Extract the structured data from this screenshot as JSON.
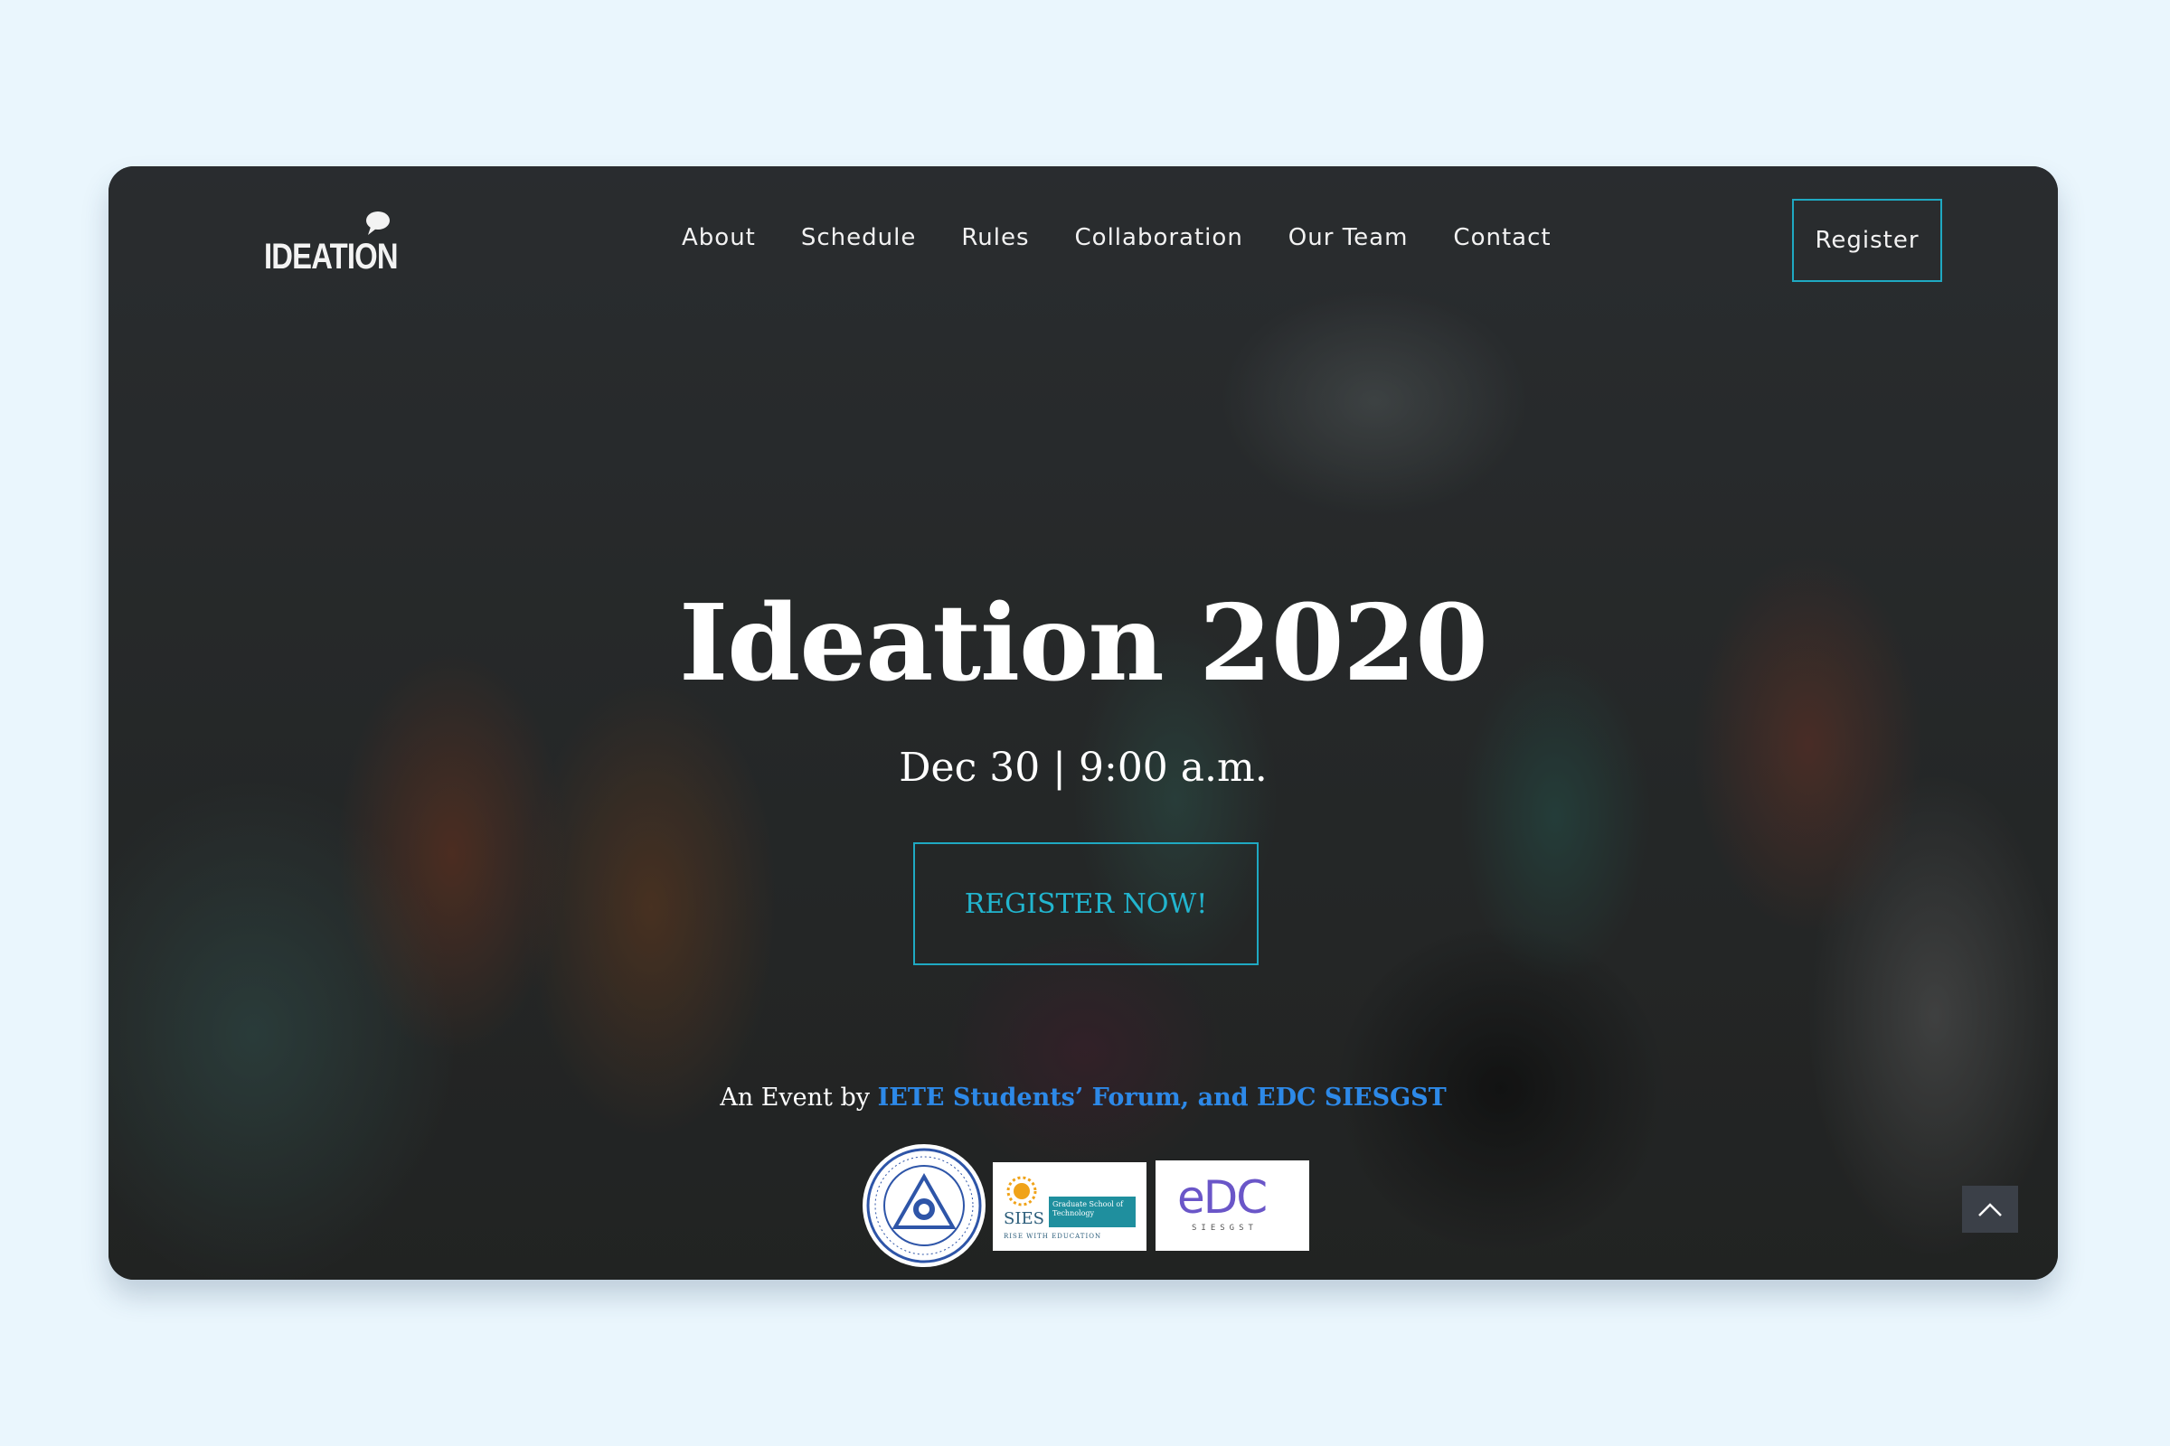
{
  "brand": {
    "logo_text": "IDEATION"
  },
  "nav": {
    "items": [
      {
        "label": "About"
      },
      {
        "label": "Schedule"
      },
      {
        "label": "Rules"
      },
      {
        "label": "Collaboration"
      },
      {
        "label": "Our Team"
      },
      {
        "label": "Contact"
      }
    ],
    "register_label": "Register"
  },
  "hero": {
    "title": "Ideation 2020",
    "date": "Dec 30 | 9:00 a.m.",
    "cta_label": "REGISTER NOW!",
    "event_prefix": "An Event by",
    "event_link": "IETE Students’ Forum, and EDC SIESGST"
  },
  "partners": {
    "sies": {
      "name": "SIES",
      "box_text": "Graduate School of Technology",
      "tagline": "RISE WITH EDUCATION"
    },
    "edc": {
      "name": "eDC",
      "sub": "SIESGST"
    }
  },
  "colors": {
    "page_bg": "#eaf6fd",
    "accent": "#1fa9c2",
    "link": "#2d89e8"
  },
  "icons": {
    "logo_bubble": "speech-bubble-icon",
    "to_top": "chevron-up-icon",
    "iete": "iete-emblem-icon"
  }
}
